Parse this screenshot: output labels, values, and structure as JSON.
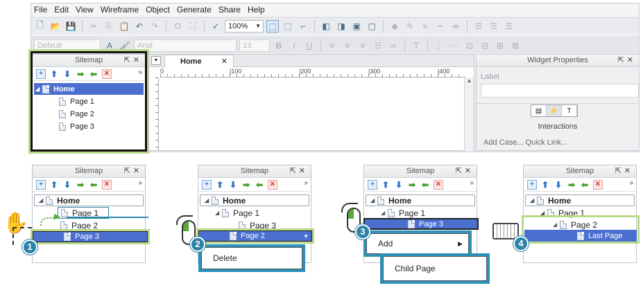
{
  "menu": [
    "File",
    "Edit",
    "View",
    "Wireframe",
    "Object",
    "Generate",
    "Share",
    "Help"
  ],
  "toolbar": {
    "zoom": "100%",
    "font_placeholder": "Default",
    "font_family": "Arial",
    "font_size": "13",
    "bold": "B",
    "italic": "I",
    "underline": "U"
  },
  "sitemap": {
    "title": "Sitemap",
    "home": "Home",
    "pages": [
      "Page 1",
      "Page 2",
      "Page 3"
    ]
  },
  "canvas": {
    "tab": "Home",
    "ruler": [
      "0",
      "|100",
      "|200",
      "|300",
      "|400"
    ]
  },
  "widget_props": {
    "title": "Widget Properties",
    "label": "Label",
    "interactions": "Interactions",
    "links": "Add Case...  Quick Link..."
  },
  "steps": [
    {
      "num": "1",
      "rows": [
        "Home",
        "Page 1",
        "Page 2",
        "Page 3"
      ]
    },
    {
      "num": "2",
      "rows": [
        "Home",
        "Page 1",
        "Page 3",
        "Page 2"
      ],
      "menu": "Delete"
    },
    {
      "num": "3",
      "rows": [
        "Home",
        "Page 1",
        "Page 3"
      ],
      "menu": "Add",
      "submenu": "Child Page"
    },
    {
      "num": "4",
      "rows": [
        "Home",
        "Page 1",
        "Page 2",
        "Last Page"
      ]
    }
  ],
  "colors": {
    "selection": "#4a6fcf",
    "badge": "#2c83a8",
    "highlight": "#b8d88a",
    "menu_border": "#2c90b8"
  }
}
